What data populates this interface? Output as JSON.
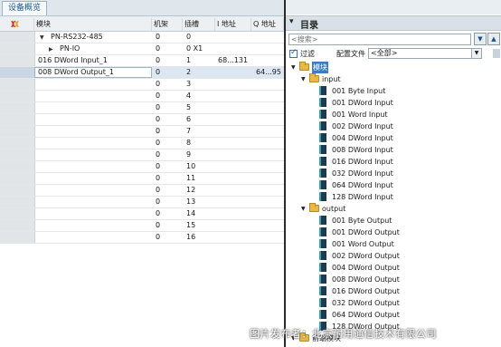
{
  "left_panel": {
    "tab": "设备概览",
    "columns": {
      "module": "模块",
      "rack": "机架",
      "slot": "插槽",
      "i_addr": "I 地址",
      "q_addr": "Q 地址"
    },
    "rows": [
      {
        "name": "PN-RS232-485",
        "rack": "0",
        "slot": "0",
        "i_addr": "",
        "q_addr": "",
        "expander": "down"
      },
      {
        "name": "PN-IO",
        "rack": "0",
        "slot": "0 X1",
        "i_addr": "",
        "q_addr": "",
        "expander": "right"
      },
      {
        "name": "016 DWord Input_1",
        "rack": "0",
        "slot": "1",
        "i_addr": "68...131",
        "q_addr": ""
      },
      {
        "name": "008 DWord Output_1",
        "rack": "0",
        "slot": "2",
        "i_addr": "",
        "q_addr": "64...95",
        "selected": true
      },
      {
        "name": "",
        "rack": "0",
        "slot": "3",
        "i_addr": "",
        "q_addr": ""
      },
      {
        "name": "",
        "rack": "0",
        "slot": "4",
        "i_addr": "",
        "q_addr": ""
      },
      {
        "name": "",
        "rack": "0",
        "slot": "5",
        "i_addr": "",
        "q_addr": ""
      },
      {
        "name": "",
        "rack": "0",
        "slot": "6",
        "i_addr": "",
        "q_addr": ""
      },
      {
        "name": "",
        "rack": "0",
        "slot": "7",
        "i_addr": "",
        "q_addr": ""
      },
      {
        "name": "",
        "rack": "0",
        "slot": "8",
        "i_addr": "",
        "q_addr": ""
      },
      {
        "name": "",
        "rack": "0",
        "slot": "9",
        "i_addr": "",
        "q_addr": ""
      },
      {
        "name": "",
        "rack": "0",
        "slot": "10",
        "i_addr": "",
        "q_addr": ""
      },
      {
        "name": "",
        "rack": "0",
        "slot": "11",
        "i_addr": "",
        "q_addr": ""
      },
      {
        "name": "",
        "rack": "0",
        "slot": "12",
        "i_addr": "",
        "q_addr": ""
      },
      {
        "name": "",
        "rack": "0",
        "slot": "13",
        "i_addr": "",
        "q_addr": ""
      },
      {
        "name": "",
        "rack": "0",
        "slot": "14",
        "i_addr": "",
        "q_addr": ""
      },
      {
        "name": "",
        "rack": "0",
        "slot": "15",
        "i_addr": "",
        "q_addr": ""
      },
      {
        "name": "",
        "rack": "0",
        "slot": "16",
        "i_addr": "",
        "q_addr": ""
      }
    ]
  },
  "catalog": {
    "title": "目录",
    "search_placeholder": "<搜索>",
    "filter_label": "过滤",
    "profile_label": "配置文件",
    "profile_value": "<全部>",
    "root": "模块",
    "input_folder": "input",
    "input_items": [
      "001 Byte Input",
      "001 DWord Input",
      "001 Word Input",
      "002 DWord Input",
      "004 DWord Input",
      "008 DWord Input",
      "016 DWord Input",
      "032 DWord Input",
      "064 DWord Input",
      "128 DWord Input"
    ],
    "output_folder": "output",
    "output_items": [
      "001 Byte Output",
      "001 DWord Output",
      "001 Word Output",
      "002 DWord Output",
      "004 DWord Output",
      "008 DWord Output",
      "016 DWord Output",
      "032 DWord Output",
      "064 DWord Output",
      "128 DWord Output"
    ],
    "bottom_item": "前端模块"
  },
  "watermark": "图片发布者：北京耐用通信技术有限公司"
}
